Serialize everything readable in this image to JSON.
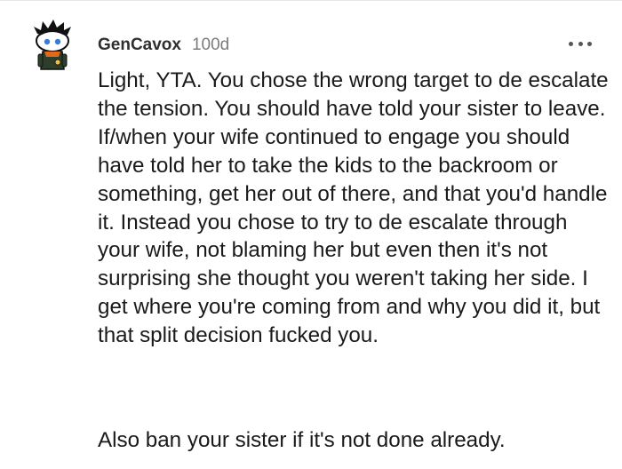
{
  "comment": {
    "author": "GenCavox",
    "age": "100d",
    "paragraphs": [
      "Light, YTA. You chose the wrong target to de escalate the tension. You should have told your sister to leave. If/when your wife continued to engage you should have told her to take the kids to the backroom or something, get her out of there, and that you'd handle it. Instead you chose to try to de escalate through your wife, not blaming her but even then it's not surprising she thought you weren't taking her side. I get where you're coming from and why you did it, but that split decision fucked you.",
      "Also ban your sister if it's not done already."
    ]
  },
  "icons": {
    "avatar": "user-avatar-icon",
    "more": "more-options-icon"
  }
}
